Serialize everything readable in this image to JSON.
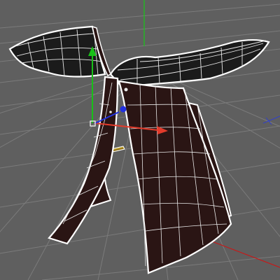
{
  "viewport": {
    "type": "3d-perspective-viewport",
    "background": "#5f5f5f",
    "grid_color": "#7b7b7b"
  },
  "model": {
    "object": "butterfly-stool",
    "display_mode": "wireframe-on-shaded",
    "selected": true,
    "wood_color": "#2a1514",
    "seat_color": "#1b1b1b",
    "wire_color": "#e8e8e8",
    "outline_color": "#ffffff"
  },
  "world_axes": {
    "y_color": "#16c816",
    "x_color": "#c81818",
    "z_color": "#2f3fcf"
  },
  "gizmo": {
    "y_axis_color": "#18c018",
    "x_axis_color": "#e33b2b",
    "z_axis_color": "#2231e0",
    "pivot_icon": "square-pivot-icon"
  }
}
